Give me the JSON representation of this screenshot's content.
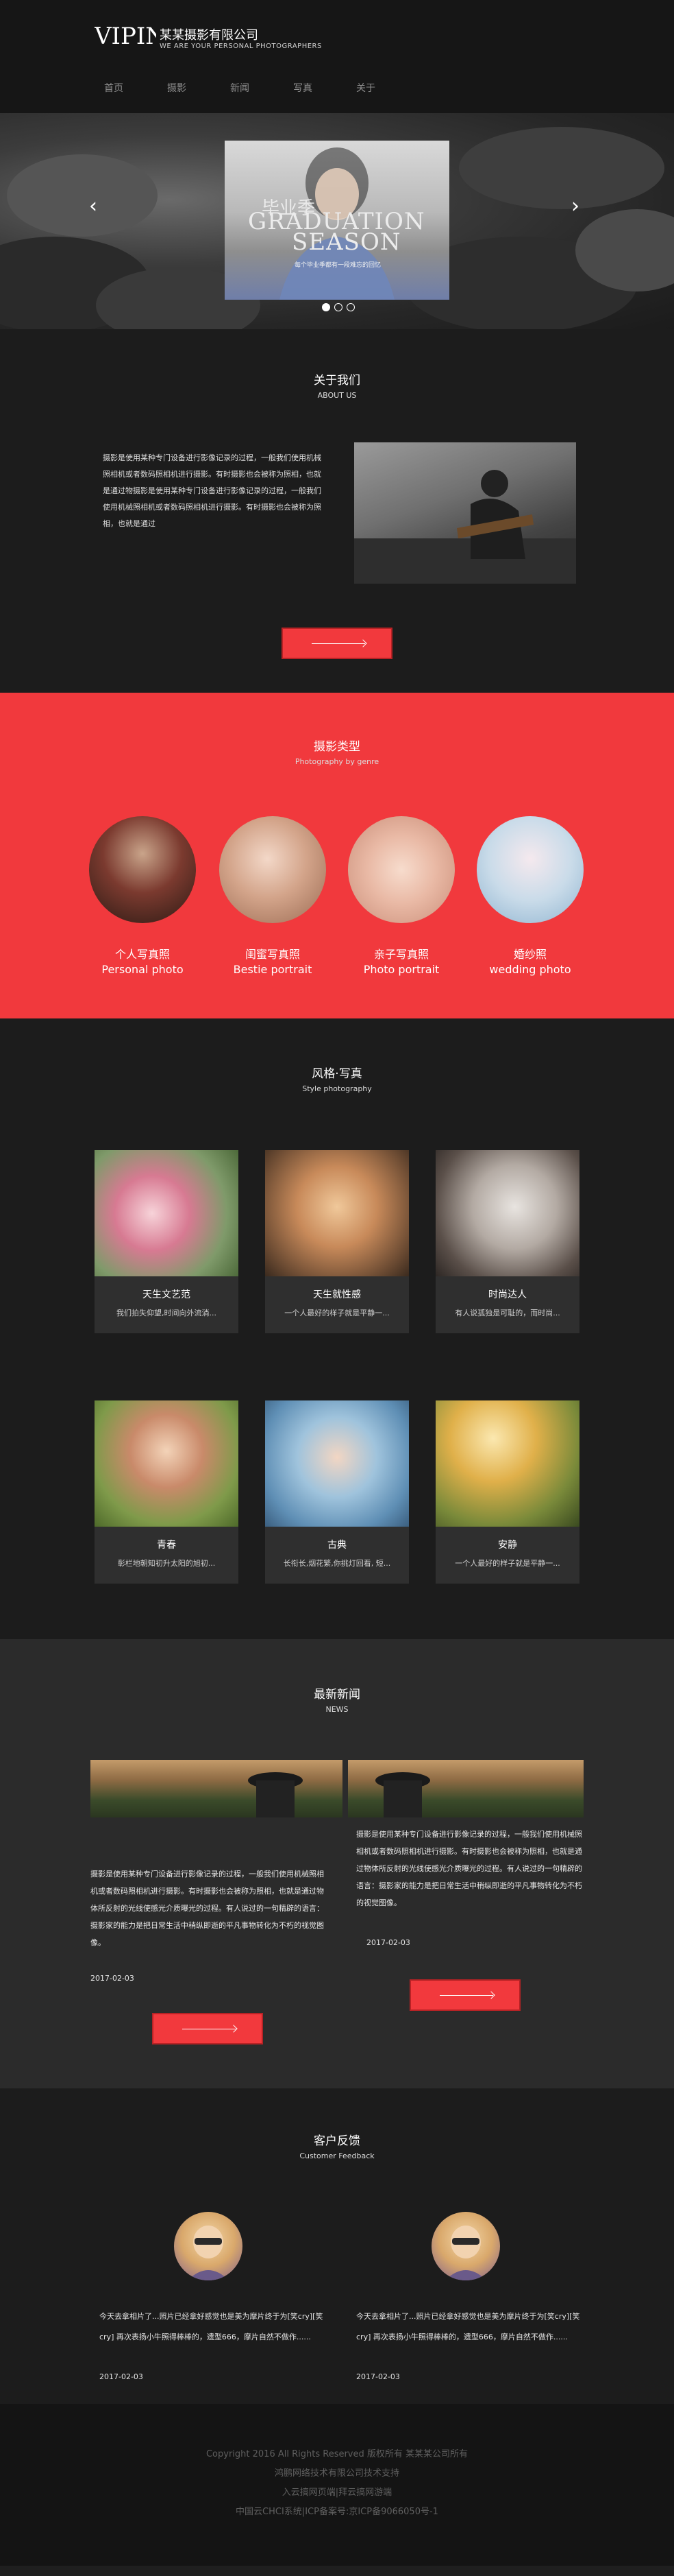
{
  "header": {
    "logo_text": "VIPIN",
    "company_name": "某某摄影有限公司",
    "slogan": "WE ARE YOUR PERSONAL PHOTOGRAPHERS",
    "nav": [
      "首页",
      "摄影",
      "新闻",
      "写真",
      "关于"
    ]
  },
  "hero": {
    "cn_title": "毕业季",
    "title_line1": "GRADUATION",
    "title_line2": "SEASON",
    "subtitle": "每个毕业季都有一段难忘的回忆",
    "slide_count": 3,
    "active_slide": 1
  },
  "about": {
    "title": "关于我们",
    "subtitle": "ABOUT US",
    "text": "摄影是使用某种专门设备进行影像记录的过程，一般我们使用机械照相机或者数码照相机进行摄影。有时摄影也会被称为照相，也就是通过物摄影是使用某种专门设备进行影像记录的过程，一般我们使用机械照相机或者数码照相机进行摄影。有时摄影也会被称为照相，也就是通过"
  },
  "genre": {
    "title": "摄影类型",
    "subtitle": "Photography by genre",
    "items": [
      {
        "cn": "个人写真照",
        "en": "Personal photo"
      },
      {
        "cn": "闺蜜写真照",
        "en": "Bestie portrait"
      },
      {
        "cn": "亲子写真照",
        "en": "Photo portrait"
      },
      {
        "cn": "婚纱照",
        "en": "wedding photo"
      }
    ]
  },
  "style": {
    "title": "风格·写真",
    "subtitle": "Style photography",
    "cards": [
      {
        "name": "天生文艺范",
        "desc": "我们拍失仰望,时间向外流淌..."
      },
      {
        "name": "天生就性感",
        "desc": "一个人最好的样子就是平静一..."
      },
      {
        "name": "时尚达人",
        "desc": "有人说孤独是可耻的，而时尚..."
      },
      {
        "name": "青春",
        "desc": "彰栏地朝知初升太阳的旭初..."
      },
      {
        "name": "古典",
        "desc": "长衔长,烟花繁,你挑灯回看, 短..."
      },
      {
        "name": "安静",
        "desc": "一个人最好的样子就是平静一..."
      }
    ]
  },
  "news": {
    "title": "最新新闻",
    "subtitle": "NEWS",
    "items": [
      {
        "text": "摄影是使用某种专门设备进行影像记录的过程，一般我们使用机械照相机或者数码照相机进行摄影。有时摄影也会被称为照相，也就是通过物体所反射的光线使感光介质曝光的过程。有人说过的一句精辟的语言：摄影家的能力是把日常生活中稍纵即逝的平凡事物转化为不朽的视觉图像。",
        "date": "2017-02-03"
      },
      {
        "text": "摄影是使用某种专门设备进行影像记录的过程，一般我们使用机械照相机或者数码照相机进行摄影。有时摄影也会被称为照相，也就是通过物体所反射的光线使感光介质曝光的过程。有人说过的一句精辟的语言：摄影家的能力是把日常生活中稍纵即逝的平凡事物转化为不朽的视觉图像。",
        "date": "2017-02-03"
      }
    ]
  },
  "feedback": {
    "title": "客户反馈",
    "subtitle": "Customer Feedback",
    "items": [
      {
        "text": "今天去拿相片了...照片已经拿好感觉也是美为摩片终于为[笑cry][笑cry] 再次表扬小牛照得棒棒的，遗型666，摩片自然不做作......",
        "date": "2017-02-03"
      },
      {
        "text": "今天去拿相片了...照片已经拿好感觉也是美为摩片终于为[笑cry][笑cry] 再次表扬小牛照得棒棒的，遗型666，摩片自然不做作......",
        "date": "2017-02-03"
      }
    ]
  },
  "footer": {
    "lines": [
      "Copyright 2016 All Rights Reserved 版权所有 某某某公司所有",
      "鸿鹏网络技术有限公司技术支持",
      "入云搞网页端|拜云搞网游端",
      "中国云CHCI系统|ICP备案号:京ICP备9066050号-1"
    ]
  },
  "colors": {
    "accent_red": "#f2393d",
    "dark_bg": "#1c1c1c",
    "card_bg": "#2f2f2f",
    "news_bg": "#2b2b2b"
  }
}
